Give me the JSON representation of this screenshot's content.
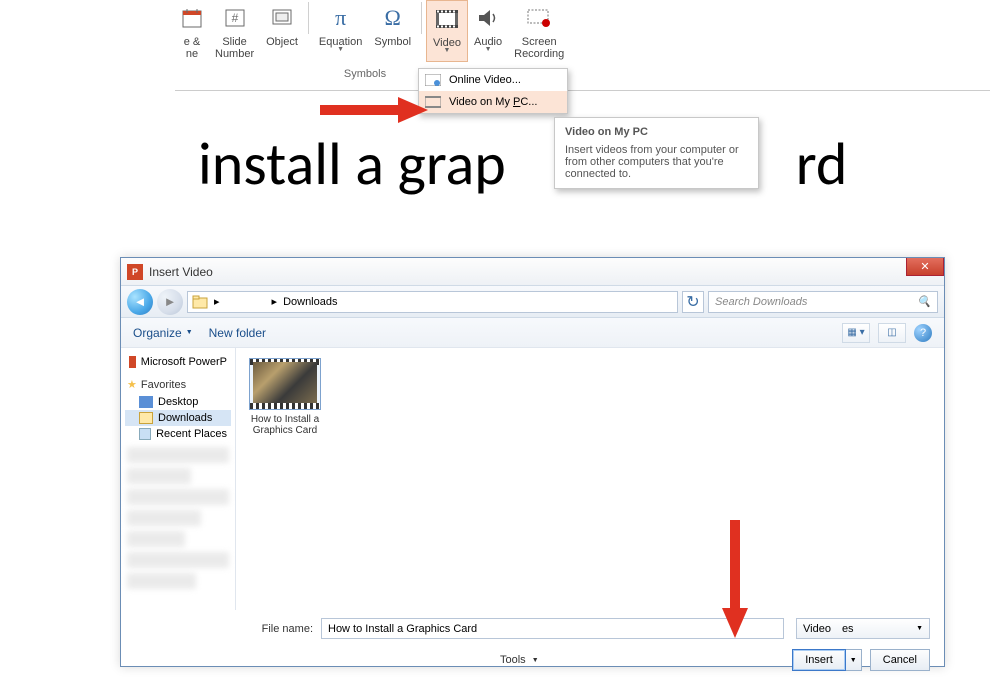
{
  "ribbon": {
    "date_time": "e &\nne",
    "date_time_line1": "e &",
    "date_time_line2": "ne",
    "slide_number_line1": "Slide",
    "slide_number_line2": "Number",
    "object": "Object",
    "equation": "Equation",
    "symbol": "Symbol",
    "video": "Video",
    "audio": "Audio",
    "screen_recording_line1": "Screen",
    "screen_recording_line2": "Recording",
    "group_symbols": "Symbols"
  },
  "menu": {
    "online_video": "Online Video...",
    "video_on_pc": "Video on My PC..."
  },
  "tooltip": {
    "title": "Video on My PC",
    "body": "Insert videos from your computer or from other computers that you're connected to."
  },
  "slide_text": "install a grap                                rd",
  "dialog": {
    "title": "Insert Video",
    "breadcrumb_sep": "▸",
    "breadcrumb_downloads": "Downloads",
    "search_placeholder": "Search Downloads",
    "organize": "Organize",
    "new_folder": "New folder",
    "sidebar": {
      "powerpoint": "Microsoft PowerP",
      "favorites": "Favorites",
      "desktop": "Desktop",
      "downloads": "Downloads",
      "recent": "Recent Places"
    },
    "file": {
      "name_line1": "How to Install a",
      "name_line2": "Graphics Card"
    },
    "footer": {
      "file_name_label": "File name:",
      "file_name_value": "How to Install a Graphics Card",
      "filter": "Video",
      "filter_suffix": "es",
      "tools": "Tools",
      "insert": "Insert",
      "cancel": "Cancel"
    }
  }
}
